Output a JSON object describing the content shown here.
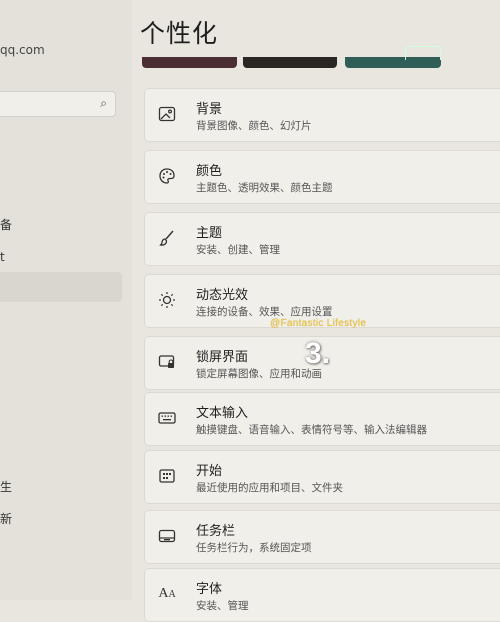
{
  "sidebar": {
    "account_email": "qq.com",
    "search_placeholder": "",
    "items": [
      {
        "label": "备"
      },
      {
        "label": "t"
      },
      {
        "label": "生"
      },
      {
        "label": "新"
      }
    ]
  },
  "main": {
    "title": "个性化",
    "theme_colors": [
      "#4a2e34",
      "#2a2624",
      "#2f5d57"
    ],
    "cards": [
      {
        "icon": "image-icon",
        "title": "背景",
        "subtitle": "背景图像、颜色、幻灯片"
      },
      {
        "icon": "palette-icon",
        "title": "颜色",
        "subtitle": "主题色、透明效果、颜色主题"
      },
      {
        "icon": "brush-icon",
        "title": "主题",
        "subtitle": "安装、创建、管理"
      },
      {
        "icon": "dynamic-lighting-icon",
        "title": "动态光效",
        "subtitle": "连接的设备、效果、应用设置"
      },
      {
        "icon": "lock-screen-icon",
        "title": "锁屏界面",
        "subtitle": "锁定屏幕图像、应用和动画"
      },
      {
        "icon": "keyboard-icon",
        "title": "文本输入",
        "subtitle": "触摸键盘、语音输入、表情符号等、输入法编辑器"
      },
      {
        "icon": "start-icon",
        "title": "开始",
        "subtitle": "最近使用的应用和项目、文件夹"
      },
      {
        "icon": "taskbar-icon",
        "title": "任务栏",
        "subtitle": "任务栏行为，系统固定项"
      },
      {
        "icon": "font-icon",
        "title": "字体",
        "subtitle": "安装、管理"
      }
    ]
  },
  "overlay": {
    "watermark": "@Fantastic Lifestyle",
    "step_number": "3."
  }
}
